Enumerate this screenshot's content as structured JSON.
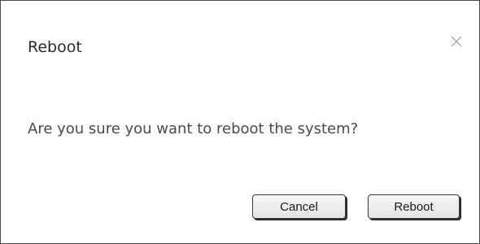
{
  "dialog": {
    "title": "Reboot",
    "close_icon": "close-icon",
    "message": "Are you sure you want to reboot the system?",
    "buttons": {
      "cancel_label": "Cancel",
      "confirm_label": "Reboot"
    }
  },
  "colors": {
    "border": "#4a4a4a",
    "title_text": "#2b2b2b",
    "message_text": "#4a4a4a",
    "close_icon": "#9a9a9a",
    "button_bg": "#ececec"
  }
}
